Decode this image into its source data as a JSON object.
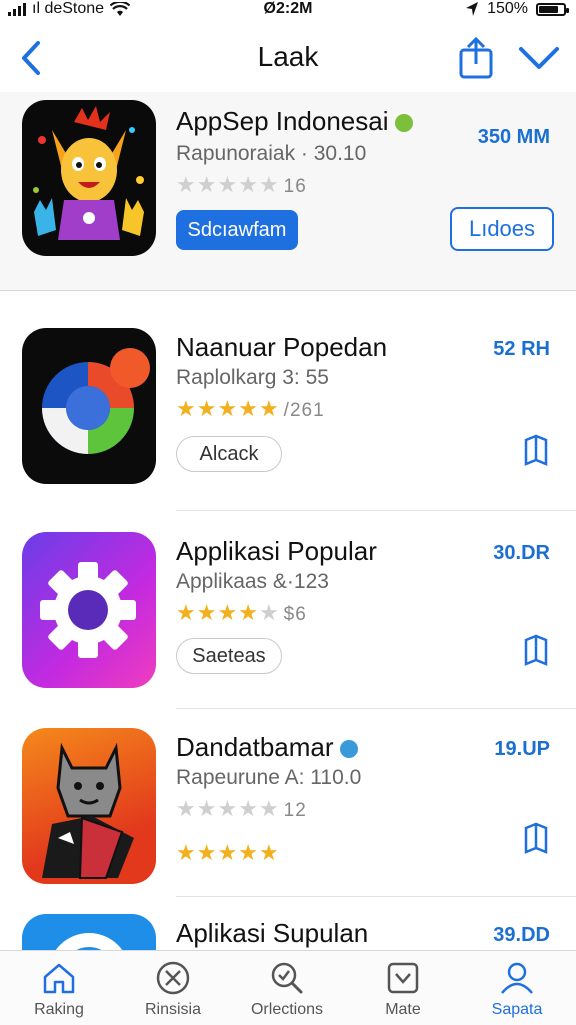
{
  "status_bar": {
    "carrier": "ıl deStone",
    "time": "Ø2:2M",
    "battery": "150%",
    "battery_level": 0.85
  },
  "nav": {
    "title": "Laak"
  },
  "featured": {
    "name": "AppSep Indonesai",
    "subtitle": "Rapunoraiak · 30.10",
    "rating_count": "16",
    "stars": 0,
    "size": "350 MM",
    "primary_button": "Sdcıawfam",
    "secondary_button": "Lıdoes",
    "badge_color": "#7bbf3a"
  },
  "apps": [
    {
      "name": "Naanuar Popedan",
      "subtitle": "Raplolkarg 3:   55",
      "stars": 5,
      "rating_count": "/261",
      "size": "52 RH",
      "button": "Alcack"
    },
    {
      "name": "Applikasi Popular",
      "subtitle": "Applikaas &·123",
      "stars": 4,
      "rating_count": "$6",
      "size": "30.DR",
      "button": "Saeteas"
    },
    {
      "name": "Dandatbamar",
      "subtitle": "Rapeurune A:  110.0",
      "stars": 0,
      "rating_count": "12",
      "size": "19.UP",
      "extra_stars": 5,
      "badge_color": "#3a9ad9"
    },
    {
      "name": "Aplikasi Supulan",
      "size": "39.DD"
    }
  ],
  "tabs": [
    {
      "label": "Raking",
      "icon": "home-icon"
    },
    {
      "label": "Rinsisia",
      "icon": "crossed-tools-icon"
    },
    {
      "label": "Orlections",
      "icon": "search-icon"
    },
    {
      "label": "Mate",
      "icon": "download-box-icon"
    },
    {
      "label": "Sapata",
      "icon": "person-icon"
    }
  ],
  "colors": {
    "accent": "#1e6fe0",
    "star": "#f2b01e"
  }
}
